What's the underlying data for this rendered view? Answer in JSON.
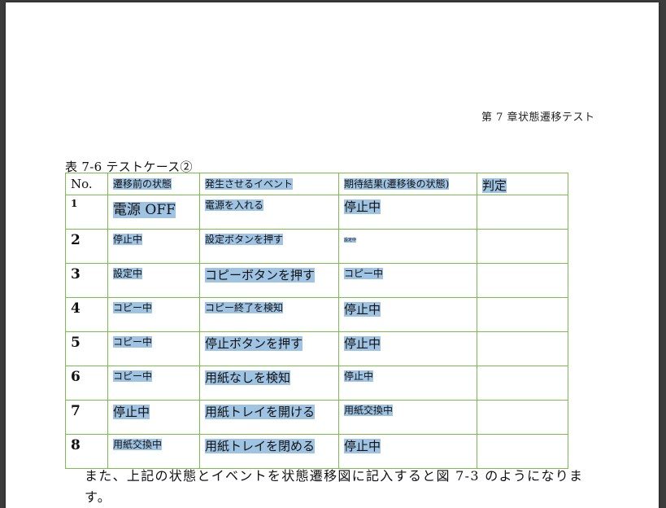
{
  "header": {
    "chapter_title": "第 7 章状態遷移テスト"
  },
  "caption": "表 7-6  テストケース②",
  "table": {
    "headers": {
      "no": "No.",
      "before": "遷移前の状態",
      "event": "発生させるイベント",
      "expected": "期待結果(遷移後の状態)",
      "judge": "判定"
    },
    "rows": [
      {
        "no": "1",
        "before": "電源 OFF",
        "event": "電源を入れる",
        "expected": "停止中",
        "judge": ""
      },
      {
        "no": "2",
        "before": "停止中",
        "event": "設定ボタンを押す",
        "expected": "設定中",
        "judge": ""
      },
      {
        "no": "3",
        "before": "設定中",
        "event": "コピーボタンを押す",
        "expected": "コピー中",
        "judge": ""
      },
      {
        "no": "4",
        "before": "コピー中",
        "event": "コピー終了を検知",
        "expected": "停止中",
        "judge": ""
      },
      {
        "no": "5",
        "before": "コピー中",
        "event": "停止ボタンを押す",
        "expected": "停止中",
        "judge": ""
      },
      {
        "no": "6",
        "before": "コピー中",
        "event": "用紙なしを検知",
        "expected": "停止中",
        "judge": ""
      },
      {
        "no": "7",
        "before": "停止中",
        "event": "用紙トレイを開ける",
        "expected": "用紙交換中",
        "judge": ""
      },
      {
        "no": "8",
        "before": "用紙交換中",
        "event": "用紙トレイを閉める",
        "expected": "停止中",
        "judge": ""
      }
    ]
  },
  "body_text": "また、上記の状態とイベントを状態遷移図に記入すると図 7-3 のようになります。",
  "colors": {
    "highlight": "#9ec3e3",
    "table_border": "#7bbf4a",
    "viewer_background": "#3c3c3c"
  }
}
